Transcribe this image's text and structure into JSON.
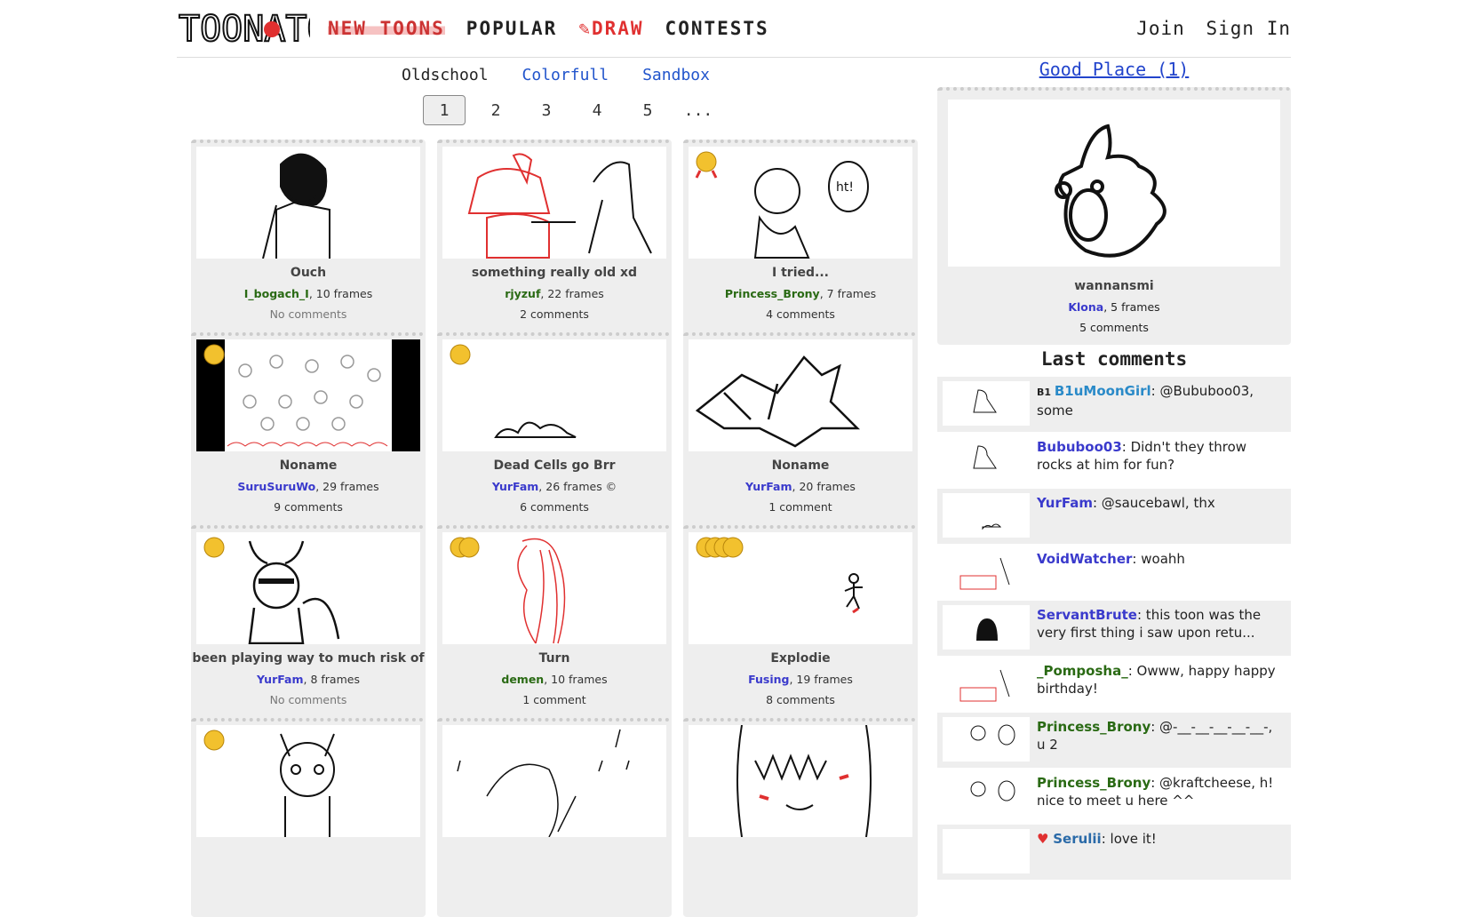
{
  "header": {
    "logo_text": "TOONATOR",
    "nav": {
      "new_toons": "NEW TOONS",
      "popular": "POPULAR",
      "draw": "DRAW",
      "contests": "CONTESTS"
    },
    "join": "Join",
    "sign_in": "Sign In"
  },
  "subtabs": {
    "oldschool": "Oldschool",
    "colorfull": "Colorfull",
    "sandbox": "Sandbox"
  },
  "pager": {
    "p1": "1",
    "p2": "2",
    "p3": "3",
    "p4": "4",
    "p5": "5",
    "more": "..."
  },
  "cards": [
    {
      "title": "Ouch",
      "user": "I_bogach_I",
      "frames": ", 10 frames",
      "comments": "No comments",
      "medals": 0
    },
    {
      "title": "something really old xd",
      "user": "rjyzuf",
      "frames": ", 22 frames",
      "comments": "2 comments",
      "medals": 0
    },
    {
      "title": "I tried...",
      "user": "Princess_Brony",
      "frames": ", 7 frames",
      "comments": "4 comments",
      "medals": 1
    },
    {
      "title": "Noname",
      "user": "SuruSuruWo",
      "frames": ", 29 frames",
      "comments": "9 comments",
      "medals": 1
    },
    {
      "title": "Dead Cells go Brr",
      "user": "YurFam",
      "frames": ", 26 frames ©",
      "comments": "6 comments",
      "medals": 1
    },
    {
      "title": "Noname",
      "user": "YurFam",
      "frames": ", 20 frames",
      "comments": "1 comment",
      "medals": 0
    },
    {
      "title": "been playing way to much risk of",
      "user": "YurFam",
      "frames": ", 8 frames",
      "comments": "No comments",
      "medals": 1
    },
    {
      "title": "Turn",
      "user": "demen",
      "frames": ", 10 frames",
      "comments": "1 comment",
      "medals": 2
    },
    {
      "title": "Explodie",
      "user": "Fusing",
      "frames": ", 19 frames",
      "comments": "8 comments",
      "medals": 3
    }
  ],
  "sidebar": {
    "good_place": "Good Place (1)",
    "featured": {
      "title": "wannansmi",
      "user": "Klona",
      "frames": ", 5 frames",
      "comments": "5 comments"
    },
    "last_comments_title": "Last comments",
    "comments": [
      {
        "user": "B1uMoonGirl",
        "text": ": @Bububoo03, some"
      },
      {
        "user": "Bububoo03",
        "text": ": Didn't they throw rocks at him for fun?"
      },
      {
        "user": "YurFam",
        "text": ": @saucebawl, thx"
      },
      {
        "user": "VoidWatcher",
        "text": ": woahh"
      },
      {
        "user": "ServantBrute",
        "text": ": this toon was the very first thing i saw upon retu..."
      },
      {
        "user": "_Pomposha_",
        "text": ": Owww, happy happy birthday!"
      },
      {
        "user": "Princess_Brony",
        "text": ": @-__-__-__-__-__-, u 2"
      },
      {
        "user": "Princess_Brony",
        "text": ": @kraftcheese, h! nice to meet u here ^^"
      },
      {
        "user": "Serulii",
        "text": ": love it!"
      }
    ]
  }
}
